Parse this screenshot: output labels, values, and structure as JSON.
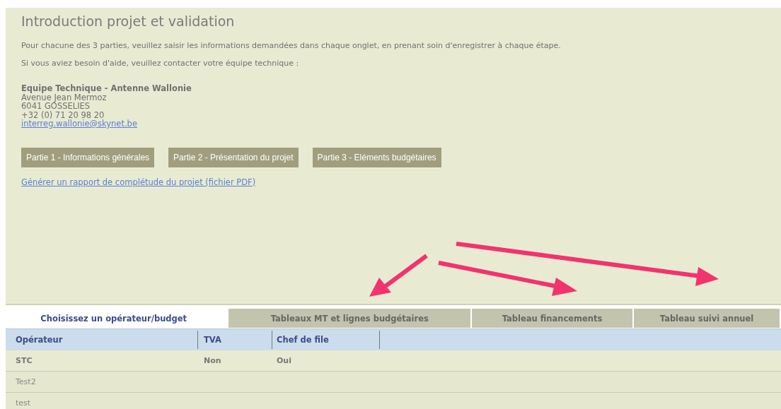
{
  "title": "Introduction projet et validation",
  "paragraphs": [
    "Pour chacune des 3 parties, veuillez saisir les informations demandées dans chaque onglet, en prenant soin d'enregistrer à chaque étape.",
    "Si vous aviez besoin d'aide, veuillez contacter votre équipe technique :"
  ],
  "contact": {
    "name": "Equipe Technique - Antenne Wallonie",
    "lines": [
      "Avenue Jean Mermoz",
      "6041 GOSSELIES",
      "+32 (0) 71 20 98 20"
    ],
    "email": "interreg.wallonie@skynet.be"
  },
  "buttons": [
    "Partie 1 - Informations générales",
    "Partie 2 - Présentation du projet",
    "Partie 3 - Eléments budgétaires"
  ],
  "report_link": "Générer un rapport de complétude du projet (fichier PDF)",
  "tabs": [
    {
      "label": "Choisissez un opérateur/budget",
      "selected": true
    },
    {
      "label": "Tableaux MT et lignes budgétaires",
      "selected": false
    },
    {
      "label": "Tableau financements",
      "selected": false
    },
    {
      "label": "Tableau suivi annuel",
      "selected": false
    }
  ],
  "table": {
    "columns": [
      "Opérateur",
      "TVA",
      "Chef de file"
    ],
    "rows": [
      {
        "cells": [
          "STC",
          "Non",
          "Oui"
        ],
        "highlighted": true
      },
      {
        "cells": [
          "Test2"
        ],
        "highlighted": false
      },
      {
        "cells": [
          "test"
        ],
        "highlighted": false
      }
    ]
  }
}
